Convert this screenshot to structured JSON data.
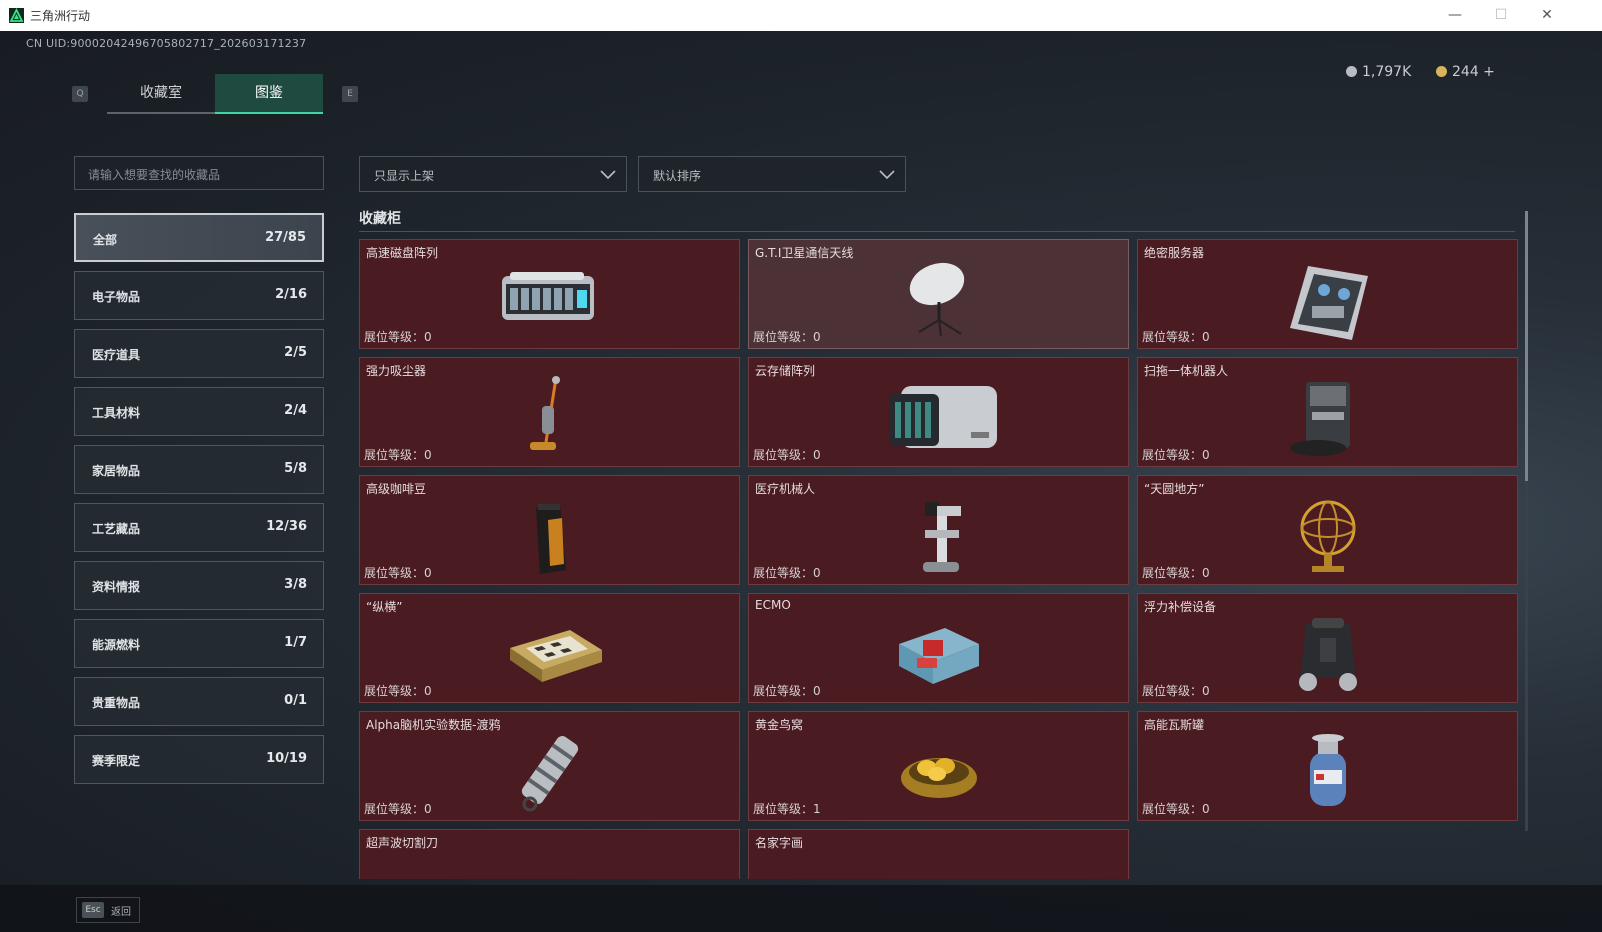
{
  "window": {
    "title": "三角洲行动",
    "minimize": "—",
    "maximize": "☐",
    "close": "✕"
  },
  "uid": "CN UID:9000204249670580271​7_202603171237",
  "tabs": [
    {
      "key": "Q",
      "label": "收藏室",
      "active": false
    },
    {
      "key": "E",
      "label": "图鉴",
      "active": true
    }
  ],
  "currency": [
    {
      "value": "1,797K",
      "color": "#b9bcc0"
    },
    {
      "value": "244 +",
      "color": "#d8b45a"
    }
  ],
  "search": {
    "placeholder": "请输入想要查找的收藏品"
  },
  "filters": {
    "shelf": "只显示上架",
    "sort": "默认排序"
  },
  "categories": [
    {
      "name": "全部",
      "count": "27/85",
      "active": true
    },
    {
      "name": "电子物品",
      "count": "2/16"
    },
    {
      "name": "医疗道具",
      "count": "2/5"
    },
    {
      "name": "工具材料",
      "count": "2/4"
    },
    {
      "name": "家居物品",
      "count": "5/8"
    },
    {
      "name": "工艺藏品",
      "count": "12/36"
    },
    {
      "name": "资料情报",
      "count": "3/8"
    },
    {
      "name": "能源燃料",
      "count": "1/7"
    },
    {
      "name": "贵重物品",
      "count": "0/1"
    },
    {
      "name": "赛季限定",
      "count": "10/19"
    }
  ],
  "section_title": "收藏柜",
  "level_label": "展位等级：",
  "items": [
    {
      "name": "高速磁盘阵列",
      "level": "0",
      "icon": "disk-array-icon"
    },
    {
      "name": "G.T.I卫星通信天线",
      "level": "0",
      "icon": "satellite-dish-icon"
    },
    {
      "name": "绝密服务器",
      "level": "0",
      "icon": "server-board-icon"
    },
    {
      "name": "强力吸尘器",
      "level": "0",
      "icon": "vacuum-cleaner-icon"
    },
    {
      "name": "云存储阵列",
      "level": "0",
      "icon": "storage-array-icon"
    },
    {
      "name": "扫拖一体机器人",
      "level": "0",
      "icon": "robot-vacuum-icon"
    },
    {
      "name": "高级咖啡豆",
      "level": "0",
      "icon": "coffee-bag-icon"
    },
    {
      "name": "医疗机械人",
      "level": "0",
      "icon": "medical-robot-icon"
    },
    {
      "name": "“天圆地方”",
      "level": "0",
      "icon": "armillary-sphere-icon"
    },
    {
      "name": "“纵横”",
      "level": "0",
      "icon": "chess-box-icon"
    },
    {
      "name": "ECMO",
      "level": "0",
      "icon": "ecmo-machine-icon"
    },
    {
      "name": "浮力补偿设备",
      "level": "0",
      "icon": "bcd-vest-icon"
    },
    {
      "name": "Alpha脑机实验数据-渡鸦",
      "level": "0",
      "icon": "data-canister-icon"
    },
    {
      "name": "黄金鸟窝",
      "level": "1",
      "icon": "golden-nest-icon"
    },
    {
      "name": "高能瓦斯罐",
      "level": "0",
      "icon": "gas-canister-icon"
    },
    {
      "name": "超声波切割刀",
      "level": "",
      "icon": ""
    },
    {
      "name": "名家字画",
      "level": "",
      "icon": ""
    }
  ],
  "footer": {
    "key": "Esc",
    "label": "返回"
  }
}
